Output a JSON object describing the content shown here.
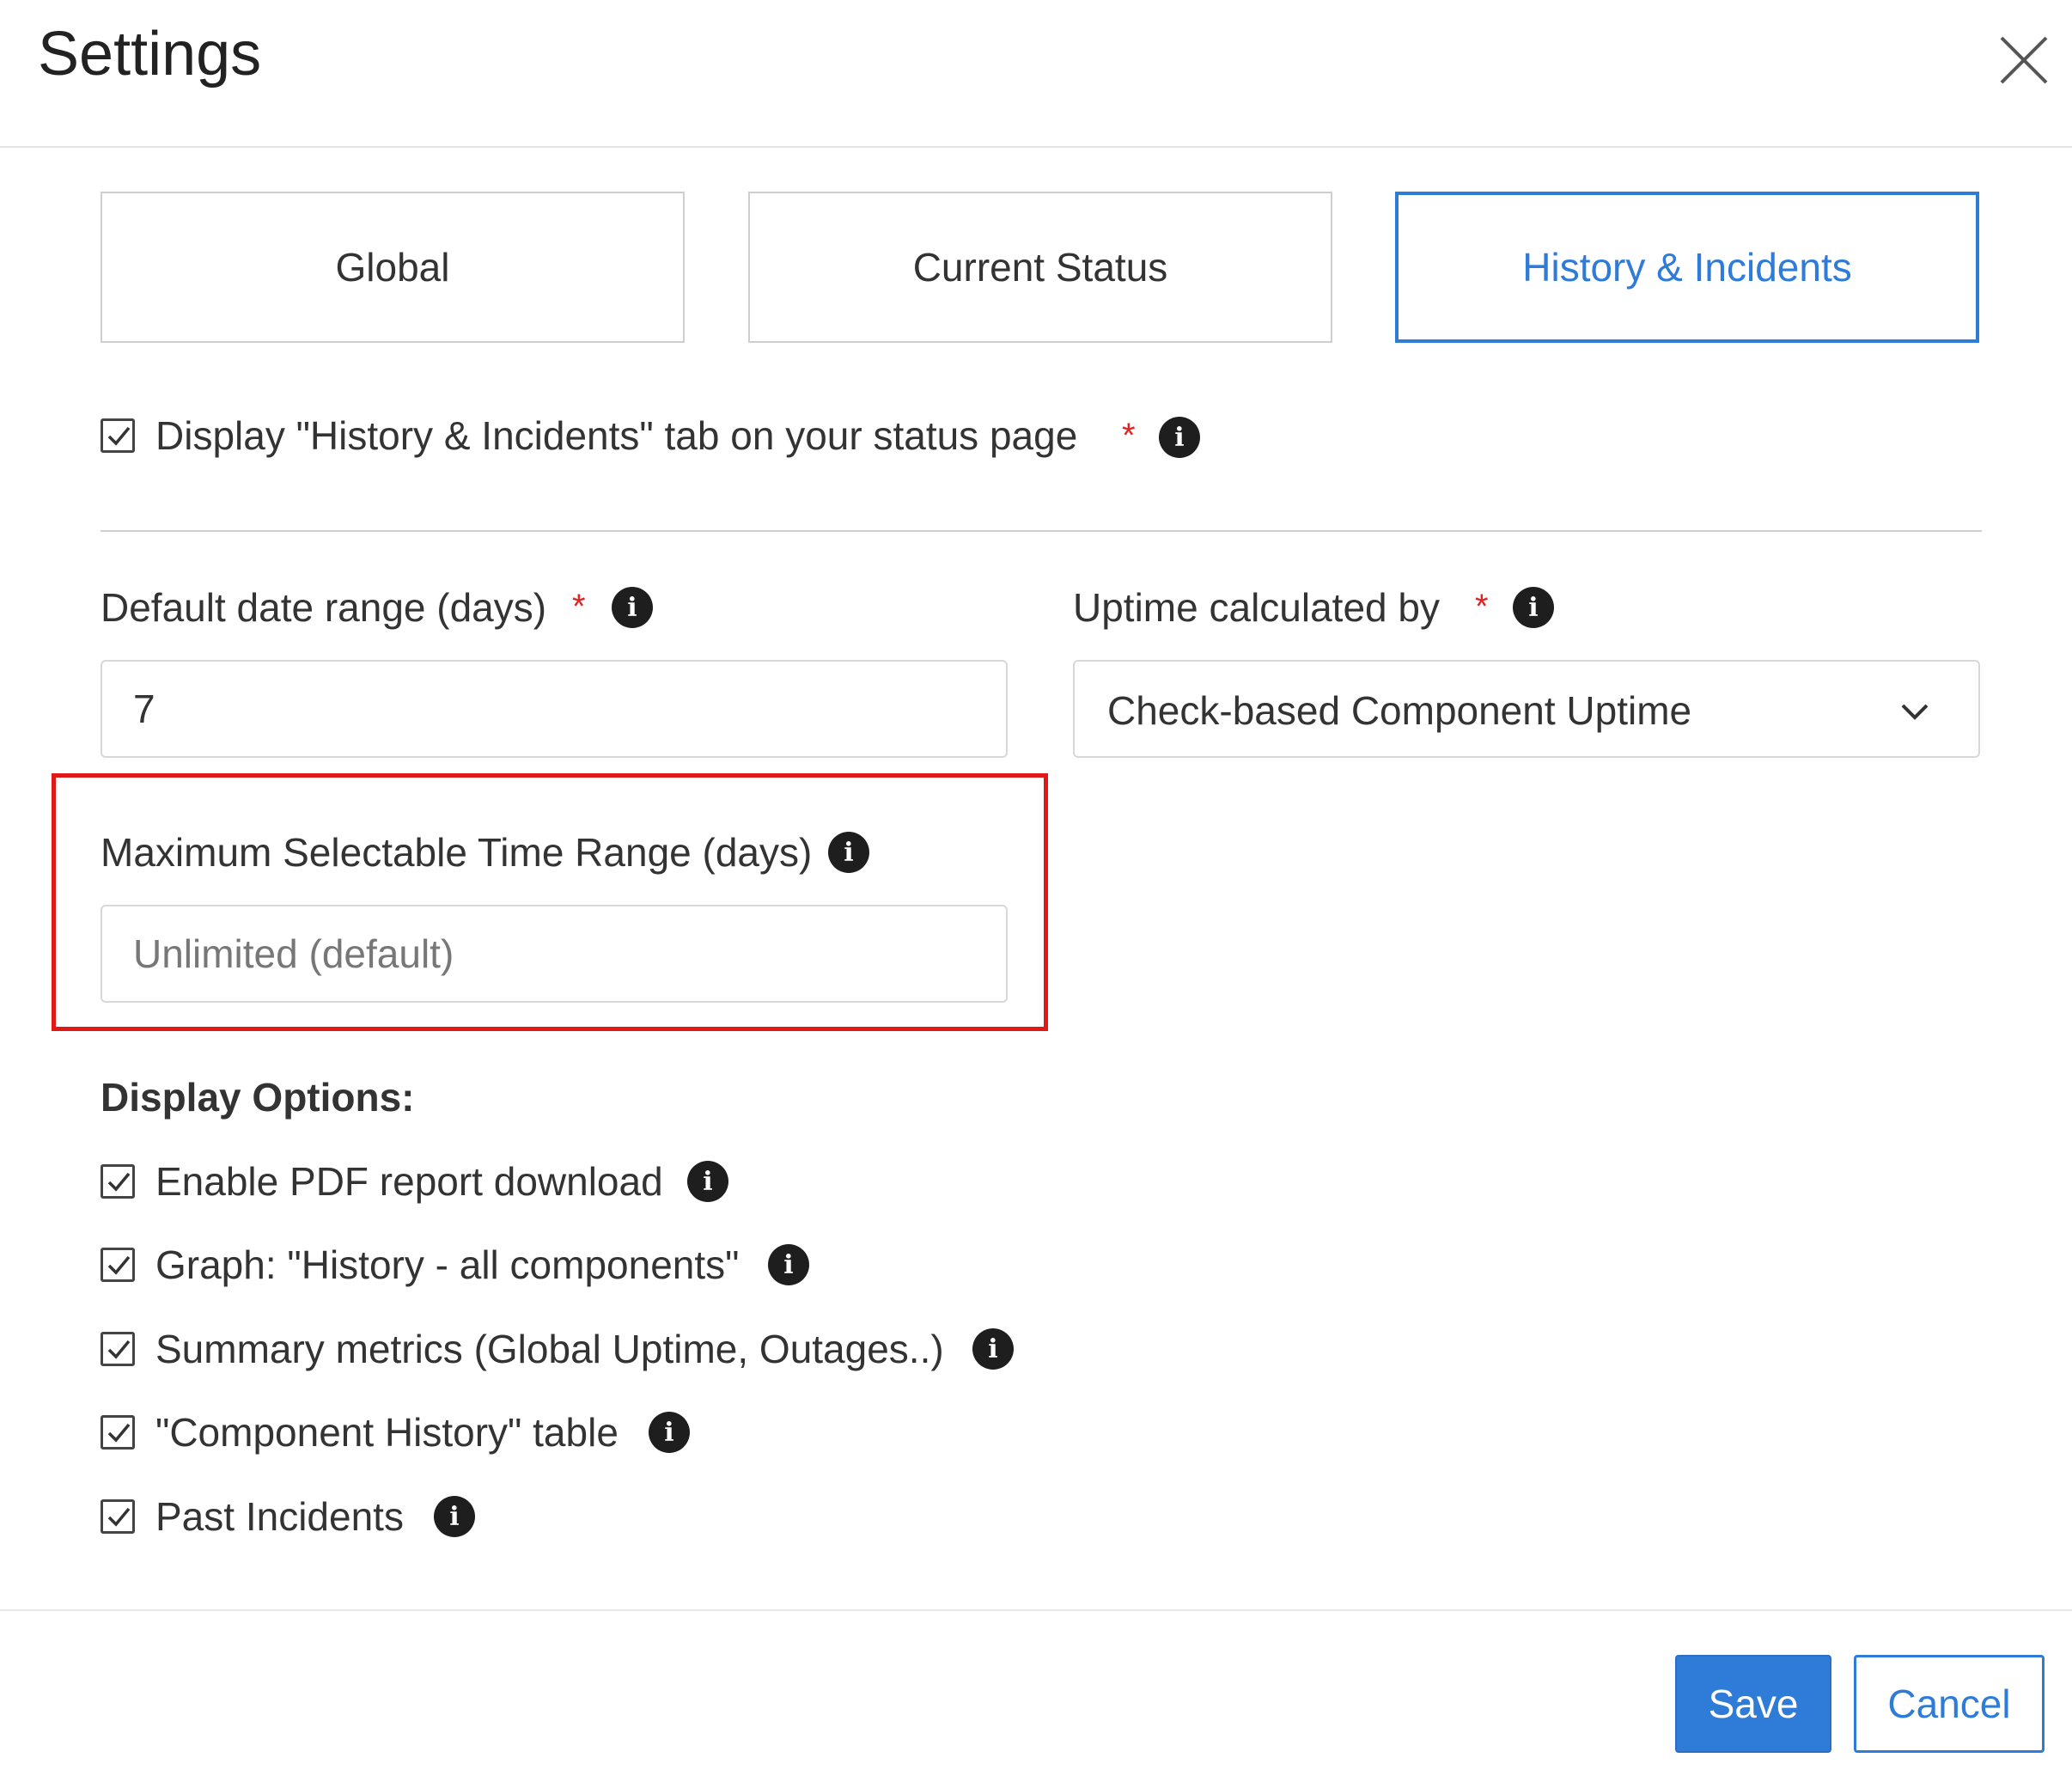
{
  "dialog": {
    "title": "Settings"
  },
  "tabs": [
    {
      "label": "Global",
      "active": false
    },
    {
      "label": "Current Status",
      "active": false
    },
    {
      "label": "History & Incidents",
      "active": true
    }
  ],
  "display_tab": {
    "label": "Display \"History & Incidents\" tab on your status page",
    "checked": true,
    "required_mark": "*"
  },
  "date_range": {
    "label": "Default date range (days)",
    "required_mark": "*",
    "value": "7"
  },
  "uptime": {
    "label": "Uptime calculated by",
    "required_mark": "*",
    "selected": "Check-based Component Uptime"
  },
  "max_range": {
    "label": "Maximum Selectable Time Range (days)",
    "placeholder": "Unlimited (default)",
    "value": ""
  },
  "display_options": {
    "title": "Display Options:",
    "items": [
      {
        "label": "Enable PDF report download",
        "checked": true
      },
      {
        "label": "Graph: \"History - all components\"",
        "checked": true
      },
      {
        "label": "Summary metrics (Global Uptime, Outages..)",
        "checked": true
      },
      {
        "label": "\"Component History\" table",
        "checked": true
      },
      {
        "label": "Past Incidents",
        "checked": true
      }
    ]
  },
  "footer": {
    "save_label": "Save",
    "cancel_label": "Cancel"
  },
  "colors": {
    "accent": "#2f7bd8",
    "required": "#e02424",
    "highlight_box": "#e01818"
  },
  "icons": {
    "close": "close-icon",
    "info": "info-icon",
    "chevron": "chevron-down-icon",
    "check": "checkmark-icon"
  }
}
